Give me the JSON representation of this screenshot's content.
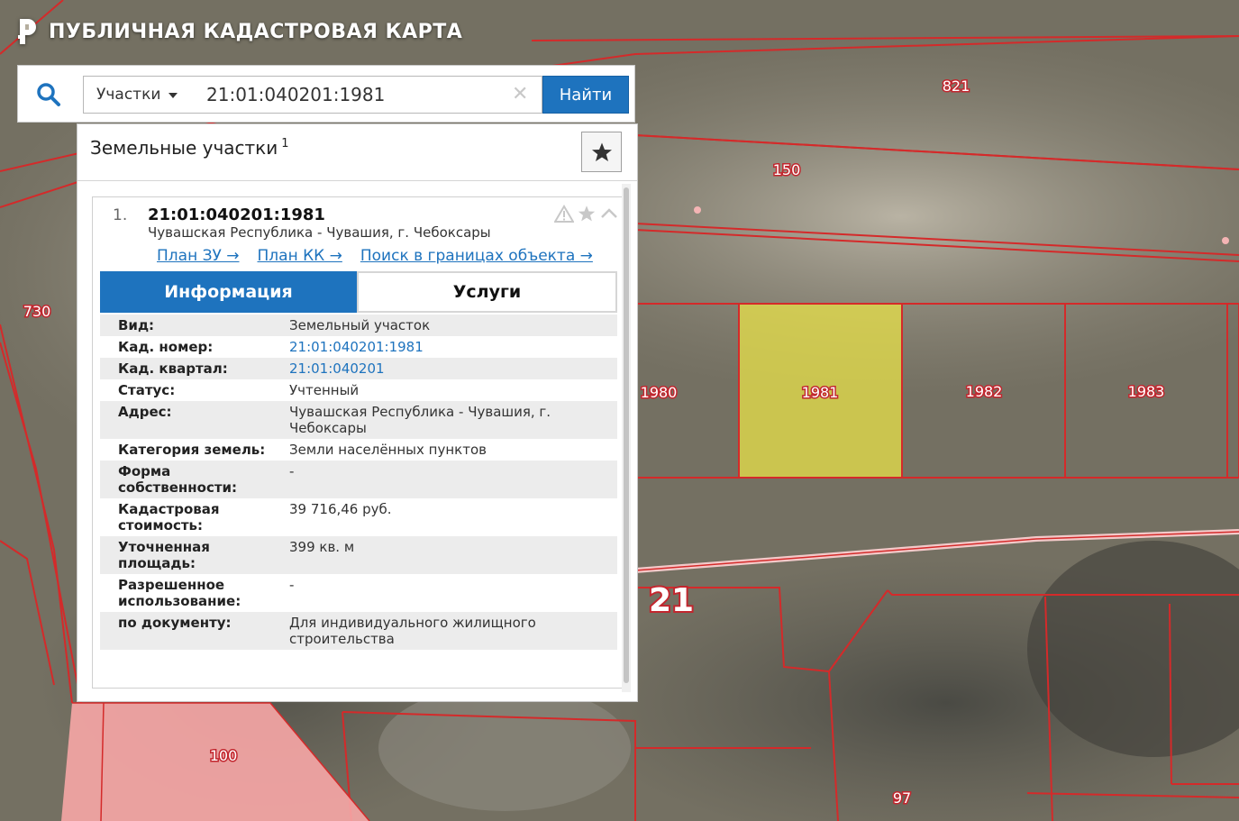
{
  "header": {
    "title": "ПУБЛИЧНАЯ КАДАСТРОВАЯ КАРТА"
  },
  "search": {
    "type_label": "Участки",
    "query": "21:01:040201:1981",
    "clear_symbol": "✕",
    "find_label": "Найти"
  },
  "panel": {
    "title": "Земельные участки",
    "count": "1"
  },
  "result": {
    "index": "1.",
    "number": "21:01:040201:1981",
    "address": "Чувашская Республика - Чувашия, г. Чебоксары",
    "links": [
      "План ЗУ →",
      "План КК →",
      "Поиск в границах объекта →"
    ],
    "tabs": [
      "Информация",
      "Услуги"
    ],
    "rows": [
      {
        "key": "Вид:",
        "value": "Земельный участок"
      },
      {
        "key": "Кад. номер:",
        "value": "21:01:040201:1981"
      },
      {
        "key": "Кад. квартал:",
        "value": "21:01:040201"
      },
      {
        "key": "Статус:",
        "value": "Учтенный"
      },
      {
        "key": "Адрес:",
        "value": "Чувашская Республика - Чувашия, г. Чебоксары"
      },
      {
        "key": "Категория земель:",
        "value": "Земли населённых пунктов"
      },
      {
        "key": "Форма собственности:",
        "value": "-"
      },
      {
        "key": "Кадастровая стоимость:",
        "value": "39 716,46 руб."
      },
      {
        "key": "Уточненная площадь:",
        "value": "399 кв. м"
      },
      {
        "key": "Разрешенное использование:",
        "value": "-"
      },
      {
        "key": "по документу:",
        "value": "Для индивидуального жилищного строительства"
      }
    ]
  },
  "map": {
    "labels": [
      "821",
      "150",
      "730",
      "1980",
      "1981",
      "1982",
      "1983",
      "21",
      "100",
      "97"
    ]
  },
  "colors": {
    "accent": "#1e73be",
    "parcel_line": "#d42a2a",
    "selected_fill": "#e8e24a"
  }
}
